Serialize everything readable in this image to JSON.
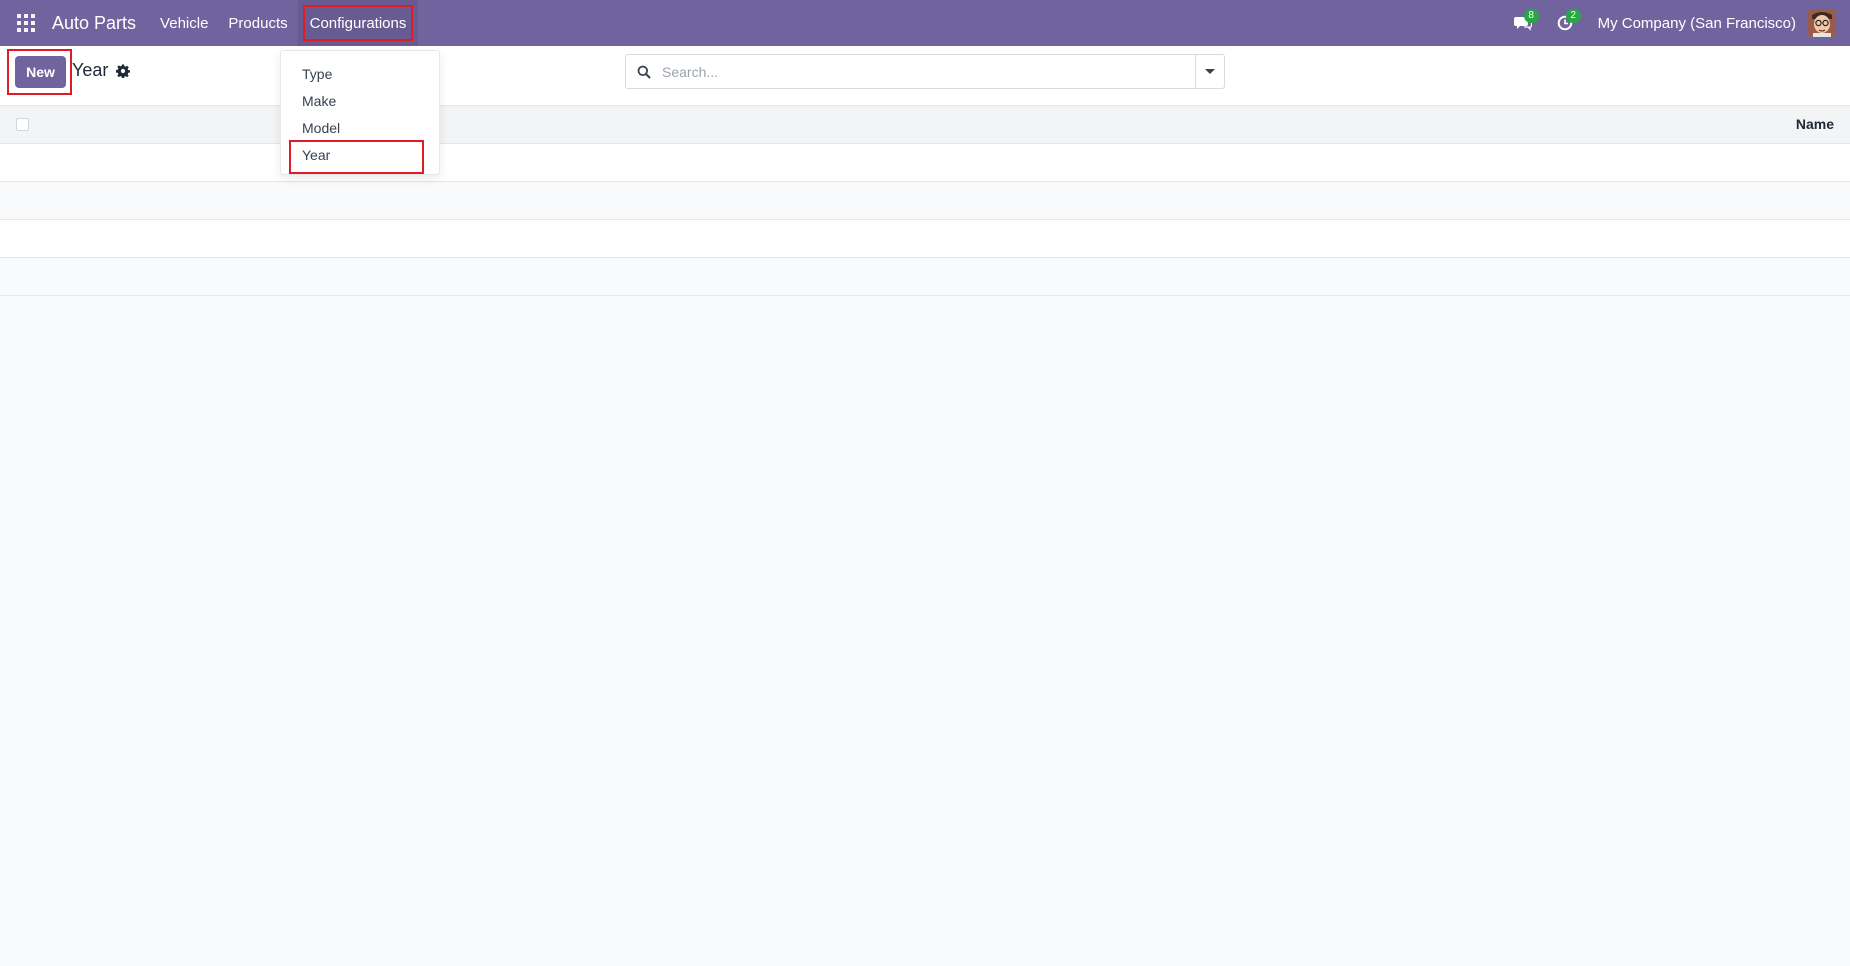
{
  "navbar": {
    "brand": "Auto Parts",
    "menu": [
      {
        "label": "Vehicle"
      },
      {
        "label": "Products"
      },
      {
        "label": "Configurations"
      }
    ],
    "messages_count": "8",
    "activities_count": "2",
    "company": "My Company (San Francisco)"
  },
  "control_panel": {
    "new_label": "New",
    "breadcrumb": "Year",
    "search_placeholder": "Search..."
  },
  "list": {
    "columns": [
      "Name"
    ],
    "rows": []
  },
  "dropdown": {
    "items": [
      {
        "label": "Type"
      },
      {
        "label": "Make"
      },
      {
        "label": "Model"
      },
      {
        "label": "Year"
      }
    ]
  },
  "colors": {
    "brand": "#71639e",
    "highlight": "#e01b24",
    "badge": "#28a745"
  }
}
